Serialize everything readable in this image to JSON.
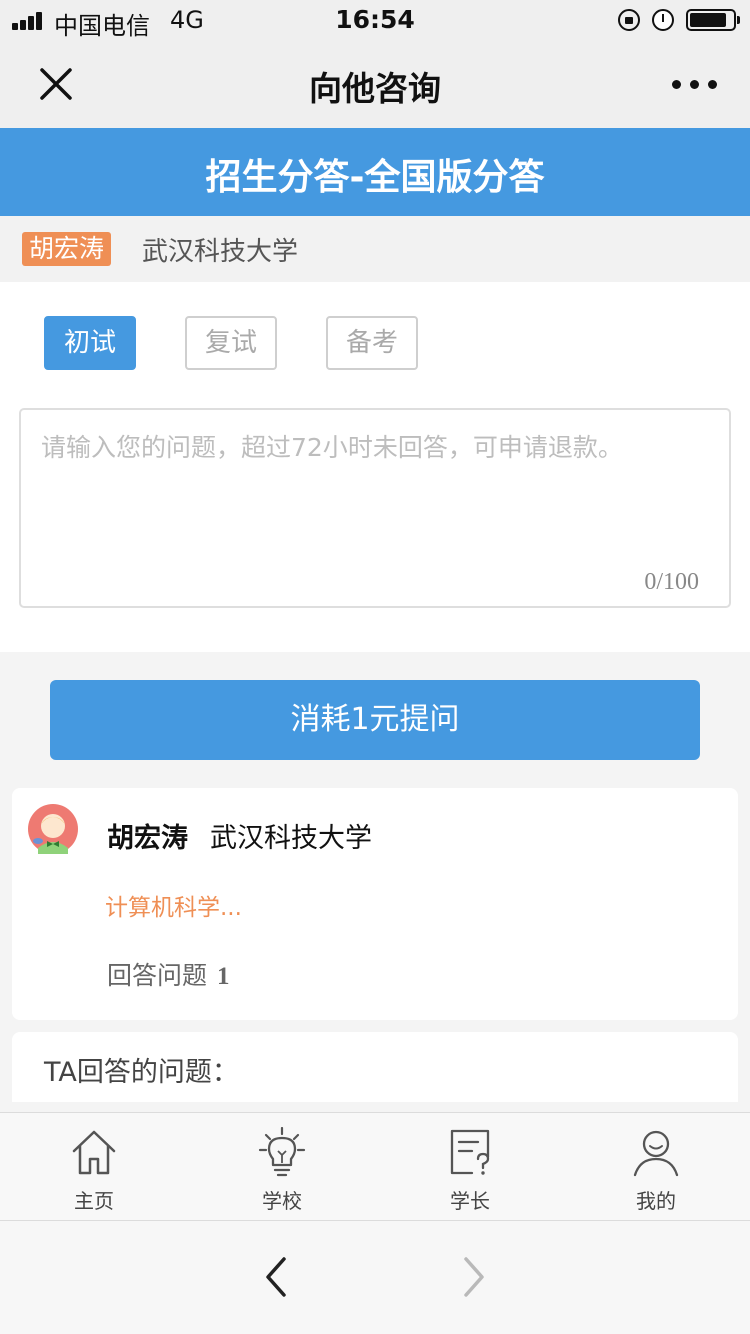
{
  "status_bar": {
    "carrier": "中国电信",
    "network": "4G",
    "time": "16:54",
    "battery_level": 0.85,
    "icons": [
      "signal-icon",
      "orientation-lock-icon",
      "alarm-icon",
      "battery-icon"
    ]
  },
  "nav": {
    "title": "向他咨询",
    "icons": [
      "close-icon",
      "more-icon"
    ]
  },
  "banner": {
    "title": "招生分答-全国版分答"
  },
  "teacher": {
    "name_tag": "胡宏涛",
    "school": "武汉科技大学"
  },
  "tabs": [
    {
      "label": "初试",
      "active": true
    },
    {
      "label": "复试",
      "active": false
    },
    {
      "label": "备考",
      "active": false
    }
  ],
  "question": {
    "placeholder": "请输入您的问题，超过72小时未回答，可申请退款。",
    "value": "",
    "counter": "0/100"
  },
  "submit": {
    "label": "消耗1元提问"
  },
  "profile": {
    "name": "胡宏涛",
    "school": "武汉科技大学",
    "major": "计算机科学...",
    "answers_label": "回答问题",
    "answers_count": "1"
  },
  "answered_section": {
    "title": "TA回答的问题："
  },
  "tab_bar": {
    "items": [
      {
        "label": "主页",
        "icon": "home-icon"
      },
      {
        "label": "学校",
        "icon": "lightbulb-icon"
      },
      {
        "label": "学长",
        "icon": "document-question-icon"
      },
      {
        "label": "我的",
        "icon": "user-icon"
      }
    ]
  },
  "browser": {
    "icons": [
      "back-arrow-icon",
      "forward-arrow-icon"
    ]
  },
  "colors": {
    "primary": "#4599e0",
    "accent": "#ef8f55",
    "background": "#f4f4f4"
  }
}
